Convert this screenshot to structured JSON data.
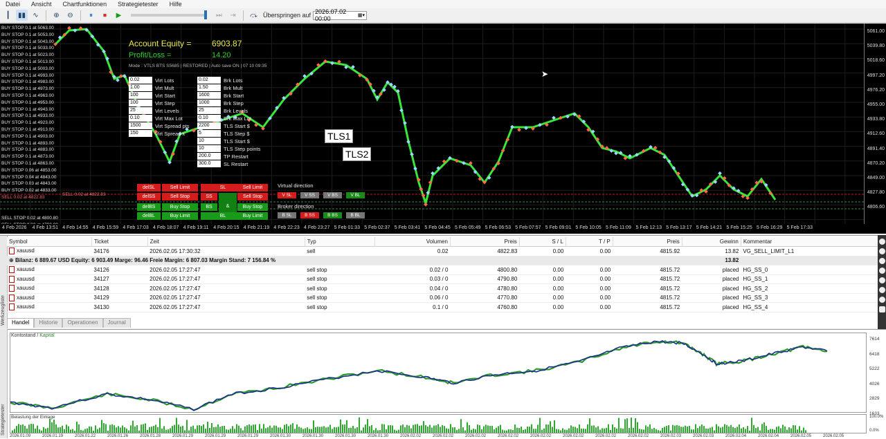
{
  "menu": [
    "Datei",
    "Ansicht",
    "Chartfunktionen",
    "Strategietester",
    "Hilfe"
  ],
  "toolbar": {
    "skip_label": "Überspringen auf",
    "skip_date": "2026.07.02 00:00"
  },
  "chart": {
    "account_equity_label": "Account Equity =",
    "account_equity_value": "6903.87",
    "profit_label": "Profit/Loss =",
    "profit_value": "14.20",
    "mode_text": "Mode : VTLS BTS S5685 | RESTORED | Auto save ON | 07 10 09:35",
    "price_ticks": [
      "5061.00",
      "5039.80",
      "5018.60",
      "4997.20",
      "4976.20",
      "4955.00",
      "4933.80",
      "4912.60",
      "4891.40",
      "4870.20",
      "4849.00",
      "4827.80",
      "4806.60"
    ],
    "time_ticks": [
      "4 Feb 2026",
      "4 Feb 13:51",
      "4 Feb 14:55",
      "4 Feb 15:59",
      "4 Feb 17:03",
      "4 Feb 18:07",
      "4 Feb 19:11",
      "4 Feb 20:15",
      "4 Feb 21:19",
      "4 Feb 22:23",
      "4 Feb 23:27",
      "5 Feb 01:33",
      "5 Feb 02:37",
      "5 Feb 03:41",
      "5 Feb 04:45",
      "5 Feb 05:49",
      "5 Feb 06:53",
      "5 Feb 07:57",
      "5 Feb 09:01",
      "5 Feb 10:05",
      "5 Feb 11:09",
      "5 Feb 12:13",
      "5 Feb 13:17",
      "5 Feb 14:21",
      "5 Feb 15:25",
      "5 Feb 16:29",
      "5 Feb 17:33"
    ],
    "orders": [
      "BUY STOP 0.1 at 5063.00",
      "BUY STOP 0.1 at 5053.00",
      "BUY STOP 0.1 at 5043.00",
      "BUY STOP 0.1 at 5033.00",
      "BUY STOP 0.1 at 5023.00",
      "BUY STOP 0.1 at 5013.00",
      "BUY STOP 0.1 at 5003.00",
      "BUY STOP 0.1 at 4993.00",
      "BUY STOP 0.1 at 4983.00",
      "BUY STOP 0.1 at 4973.00",
      "BUY STOP 0.1 at 4963.00",
      "BUY STOP 0.1 at 4953.00",
      "BUY STOP 0.1 at 4943.00",
      "BUY STOP 0.1 at 4933.00",
      "BUY STOP 0.1 at 4923.00",
      "BUY STOP 0.1 at 4913.00",
      "BUY STOP 0.1 at 4903.00",
      "BUY STOP 0.1 at 4893.00",
      "BUY STOP 0.1 at 4883.00",
      "BUY STOP 0.1 at 4873.00",
      "BUY STOP 0.1 at 4863.00",
      "BUY STOP 0.06 at 4853.00",
      "BUY STOP 0.04 at 4843.00",
      "BUY STOP 0.03 at 4843.00",
      "BUY STOP 0.02 at 4833.00",
      "SELL 0.02 at 4822.83"
    ],
    "lower_orders": [
      "SELL STOP 0.02 at 4800.80",
      "SELL STOP 0.03 at 4790.80"
    ],
    "virt_params": [
      {
        "value": "0.02",
        "label": "Virt Lots"
      },
      {
        "value": "1.00",
        "label": "Virt Mult"
      },
      {
        "value": "100",
        "label": "Virt Start"
      },
      {
        "value": "100",
        "label": "Virt Step"
      },
      {
        "value": "25",
        "label": "Virt Levels"
      },
      {
        "value": "0.10",
        "label": "Virt Max Lot"
      },
      {
        "value": "1500",
        "label": "Virt Spread pts"
      },
      {
        "value": "150",
        "label": "Virt Spread x"
      }
    ],
    "brk_params": [
      {
        "value": "0.02",
        "label": "Brk Lots"
      },
      {
        "value": "1.50",
        "label": "Brk Mult"
      },
      {
        "value": "1600",
        "label": "Brk Start"
      },
      {
        "value": "1000",
        "label": "Brk Step"
      },
      {
        "value": "25",
        "label": "Brk Levels"
      },
      {
        "value": "0.10",
        "label": "Brk Max Lot"
      },
      {
        "value": "2200",
        "label": "TLS Start $"
      },
      {
        "value": "5",
        "label": "TLS Step $"
      },
      {
        "value": "10",
        "label": "TLS Start $"
      },
      {
        "value": "10",
        "label": "TLS Step points"
      },
      {
        "value": "200.0",
        "label": "TP Restart"
      },
      {
        "value": "300.0",
        "label": "SL Restart"
      }
    ],
    "tls1": "TLS1",
    "tls2": "TLS2",
    "buttons": {
      "delSL": "delSL",
      "sellLimit": "Sell Limit",
      "sl": "SL",
      "sellLimit2": "Sell Limit",
      "delSS": "delSS",
      "sellStop": "Sell Stop",
      "ss": "SS",
      "sellStop2": "Sell Stop",
      "delBS": "delBS",
      "buyStop": "Buy Stop",
      "bs": "BS",
      "amp": "&",
      "buyStop2": "Buy Stop",
      "delBL": "delBL",
      "buyLimit": "Buy Limit",
      "bl": "BL",
      "buyLimit2": "Buy Limit"
    },
    "virtual_direction": "Virtual direction",
    "broker_direction": "Broker direction",
    "dir_buttons": [
      "V SL",
      "V SS",
      "V BS",
      "V BL"
    ],
    "brk_buttons": [
      "B SL",
      "B SS",
      "B BS",
      "B BL"
    ],
    "sell_tag": "SELL 0.02 at 4822.83"
  },
  "terminal": {
    "columns": [
      "Symbol",
      "Ticket",
      "Zeit",
      "Typ",
      "Volumen",
      "Preis",
      "S / L",
      "T / P",
      "Preis",
      "Gewinn",
      "Kommentar"
    ],
    "first_row": [
      "xauusd",
      "34176",
      "2026.02.05 17:30:32",
      "sell",
      "0.02",
      "4822.83",
      "0.00",
      "0.00",
      "4815.92",
      "13.82",
      "VG_SELL_LIMIT_L1"
    ],
    "summary": "Bilanz: 6 889.67 USD  Equity: 6 903.49  Marge: 96.46  Freie Margin: 6 807.03  Margin Stand: 7 156.84 %",
    "summary_profit": "13.82",
    "rows": [
      [
        "xauusd",
        "34126",
        "2026.02.05 17:27:47",
        "sell stop",
        "0.02 / 0",
        "4800.80",
        "0.00",
        "0.00",
        "4815.72",
        "placed",
        "HG_SS_0"
      ],
      [
        "xauusd",
        "34127",
        "2026.02.05 17:27:47",
        "sell stop",
        "0.03 / 0",
        "4790.80",
        "0.00",
        "0.00",
        "4815.72",
        "placed",
        "HG_SS_1"
      ],
      [
        "xauusd",
        "34128",
        "2026.02.05 17:27:47",
        "sell stop",
        "0.04 / 0",
        "4780.80",
        "0.00",
        "0.00",
        "4815.72",
        "placed",
        "HG_SS_2"
      ],
      [
        "xauusd",
        "34129",
        "2026.02.05 17:27:47",
        "sell stop",
        "0.06 / 0",
        "4770.80",
        "0.00",
        "0.00",
        "4815.72",
        "placed",
        "HG_SS_3"
      ],
      [
        "xauusd",
        "34130",
        "2026.02.05 17:27:47",
        "sell stop",
        "0.1 / 0",
        "4760.80",
        "0.00",
        "0.00",
        "4815.72",
        "placed",
        "HG_SS_4"
      ]
    ],
    "tabs": [
      "Handel",
      "Historie",
      "Operationen",
      "Journal"
    ],
    "side_label": "Werkzeugliste"
  },
  "equity": {
    "title_balance": "Kontostand",
    "title_equity": "Kapital",
    "axis": [
      "7614",
      "6418",
      "5222",
      "4026",
      "2829",
      "1633"
    ],
    "load_title": "Belastung der Einlage",
    "load_axis": [
      "100.0%",
      "0.0%"
    ],
    "dates": [
      "2026.01.09",
      "2026.01.19",
      "2026.01.22",
      "2026.01.26",
      "2026.01.28",
      "2026.01.29",
      "2026.01.29",
      "2026.01.29",
      "2026.01.30",
      "2026.01.30",
      "2026.01.30",
      "2026.01.30",
      "2026.02.02",
      "2026.02.02",
      "2026.02.02",
      "2026.02.02",
      "2026.02.02",
      "2026.02.02",
      "2026.02.02",
      "2026.02.02",
      "2026.02.03",
      "2026.02.03",
      "2026.02.04",
      "2026.02.04",
      "2026.02.05",
      "2026.02.05"
    ],
    "side_label": "Strategietester",
    "colors": {
      "balance": "#1a2e8a",
      "equity": "#2a9a2a"
    }
  }
}
